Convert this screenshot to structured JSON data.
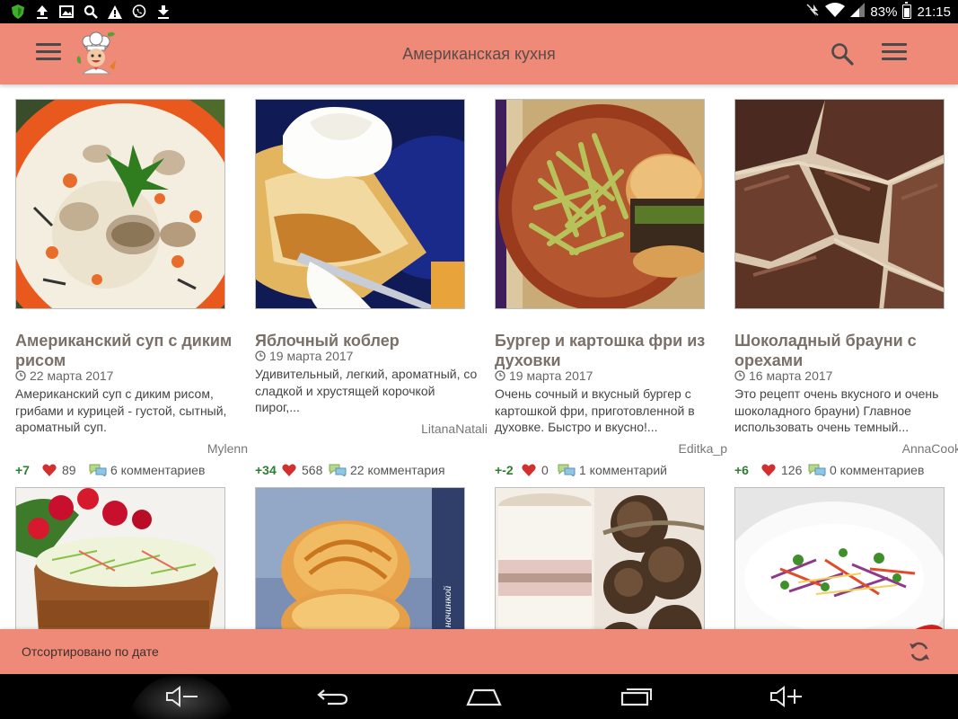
{
  "status_bar": {
    "battery": "83%",
    "battery_level": 0.83,
    "time": "21:15",
    "left_icons": [
      "shield-icon",
      "upload-icon",
      "image-icon",
      "search-icon",
      "warning-icon",
      "viber-icon",
      "download-icon"
    ],
    "right_icons": [
      "mute-icon",
      "wifi-icon",
      "signal-icon",
      "battery-icon"
    ]
  },
  "toolbar": {
    "title": "Американская кухня",
    "menu_icon": "hamburger-menu-icon",
    "logo": "chef-logo",
    "search_icon": "search-icon",
    "more_icon": "menu-icon"
  },
  "recipes": [
    {
      "title": "Американский суп с диким рисом",
      "date": "22 марта 2017",
      "description": "Американский суп с диким рисом, грибами и курицей - густой, сытный, ароматный суп.",
      "author": "Mylenn",
      "rating": "+7",
      "likes": "89",
      "comments": "6 комментариев"
    },
    {
      "title": "Яблочный коблер",
      "date": "19 марта 2017",
      "description": "Удивительный, легкий, ароматный, со сладкой и хрустящей корочкой пирог,...",
      "author": "LitanaNatali",
      "rating": "+34",
      "likes": "568",
      "comments": "22 комментария"
    },
    {
      "title": "Бургер и картошка фри из духовки",
      "date": "19 марта 2017",
      "description": "Очень сочный и вкусный бургер с картошкой фри, приготовленной в духовке. Быстро и вкусно!...",
      "author": "Editka_p",
      "rating": "+-2",
      "likes": "0",
      "comments": "1 комментарий"
    },
    {
      "title": "Шоколадный брауни с орехами",
      "date": "16 марта 2017",
      "description": "Это рецепт очень вкусного и очень шоколадного брауни) Главное использовать очень темный...",
      "author": "AnnaCooks",
      "rating": "+6",
      "likes": "126",
      "comments": "0 комментариев"
    }
  ],
  "second_row": [
    {
      "image": "radish-salad-photo"
    },
    {
      "image": "rose-bun-photo",
      "watermark": "с шоколадной начинкой"
    },
    {
      "image": "crackers-jar-photo"
    },
    {
      "image": "cabbage-salad-photo"
    }
  ],
  "sort_bar": {
    "label": "Отсортировано по дате",
    "refresh_icon": "refresh-icon"
  },
  "nav_bar": {
    "buttons": [
      "volume-down-icon",
      "back-icon",
      "home-icon",
      "recents-icon",
      "volume-up-icon"
    ]
  },
  "colors": {
    "accent": "#f08a78",
    "rating_green": "#2e7d32",
    "heart": "#d32f2f",
    "title_gray": "#7a7068"
  }
}
